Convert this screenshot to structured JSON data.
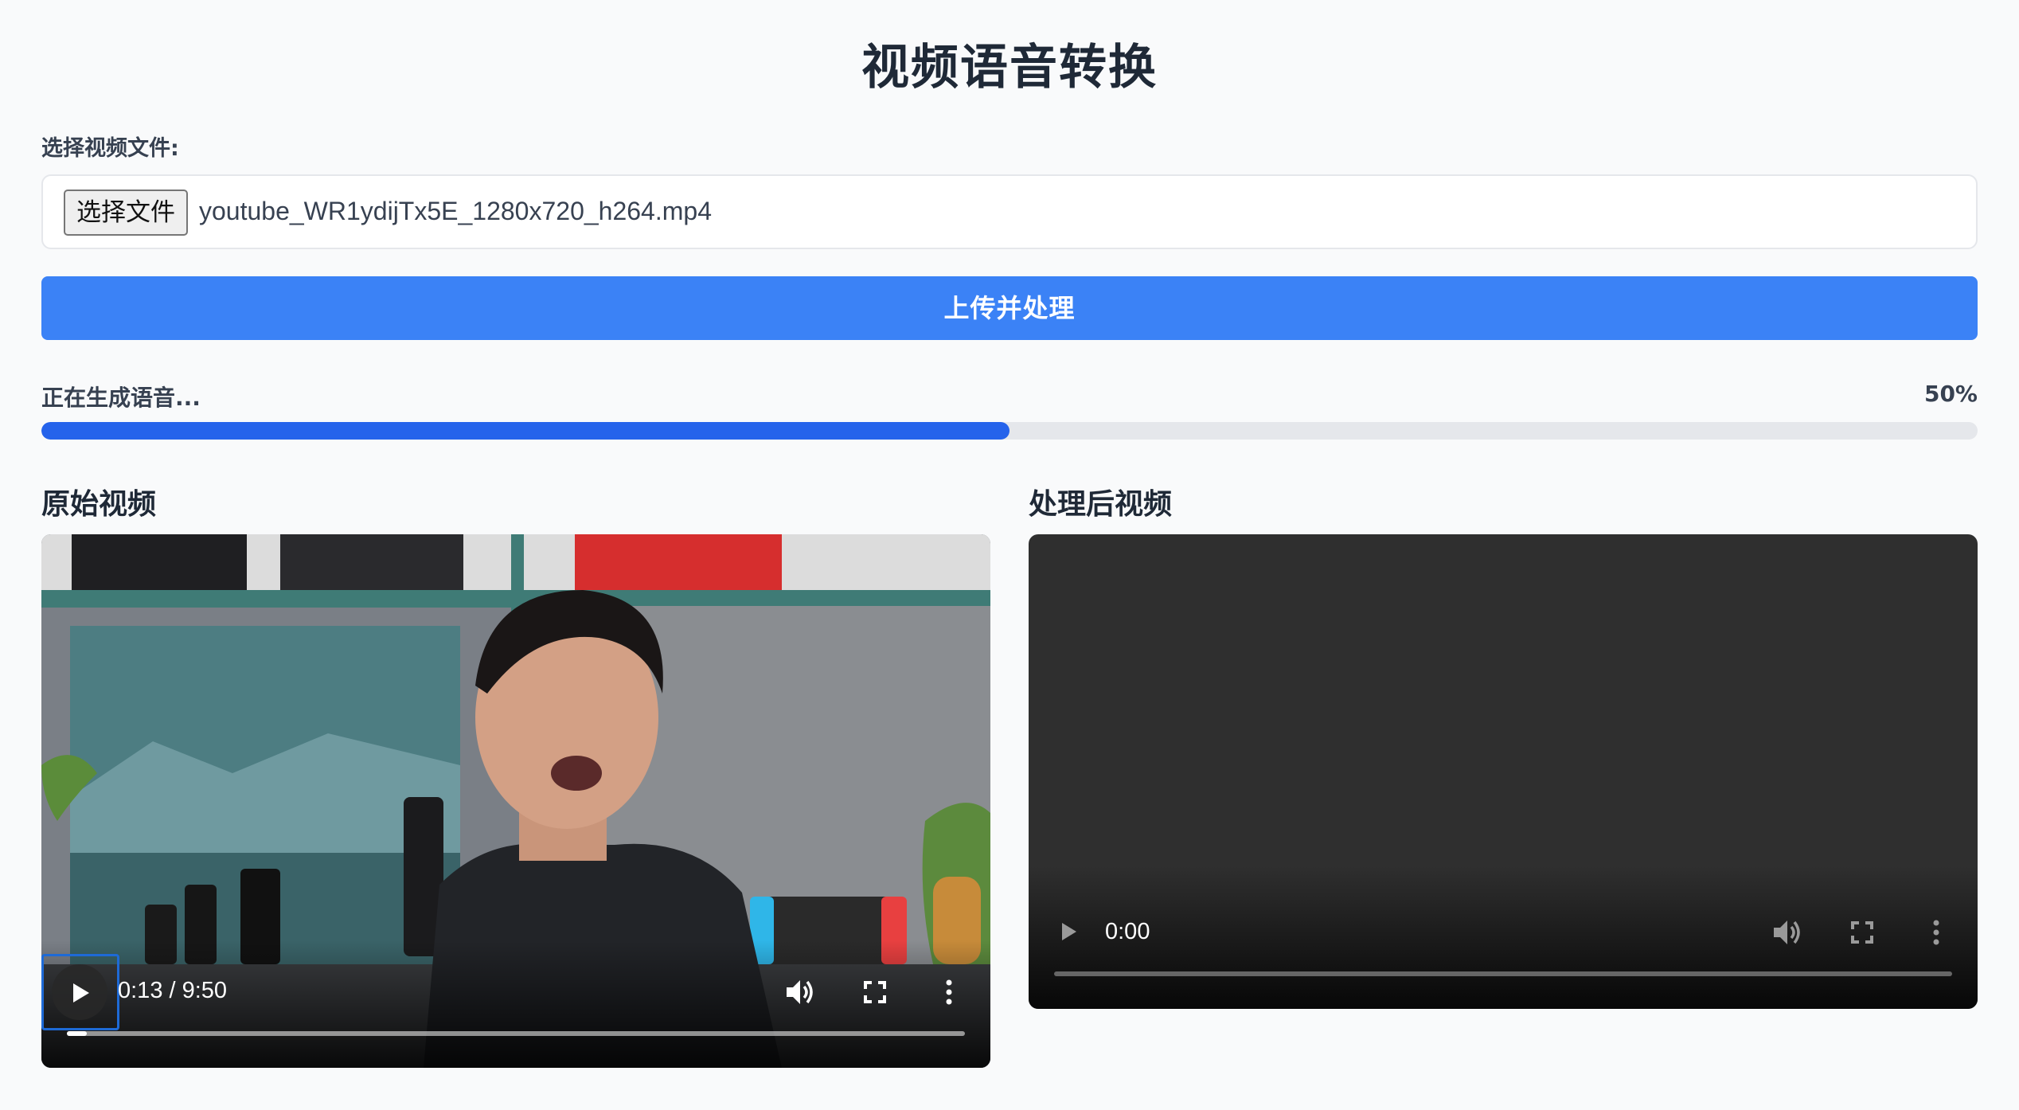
{
  "page": {
    "title": "视频语音转换"
  },
  "file_input": {
    "label": "选择视频文件:",
    "button_label": "选择文件",
    "file_name": "youtube_WR1ydijTx5E_1280x720_h264.mp4"
  },
  "upload": {
    "button_label": "上传并处理"
  },
  "progress": {
    "status": "正在生成语音...",
    "percent_label": "50%",
    "value": 0.5
  },
  "original_video": {
    "title": "原始视频",
    "time": "0:13 / 9:50",
    "played_fraction": 0.022
  },
  "processed_video": {
    "title": "处理后视频",
    "time": "0:00",
    "played_fraction": 0
  },
  "colors": {
    "accent": "#3b82f6",
    "progress_fill": "#2563eb",
    "progress_track": "#e5e7eb"
  }
}
